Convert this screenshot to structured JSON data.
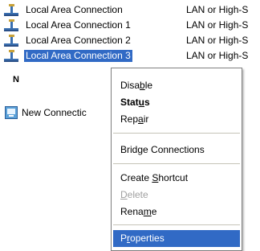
{
  "connections": [
    {
      "name": "Local Area Connection",
      "type": "LAN or High-S"
    },
    {
      "name": "Local Area Connection 1",
      "type": "LAN or High-S"
    },
    {
      "name": "Local Area Connection 2",
      "type": "LAN or High-S"
    },
    {
      "name": "Local Area Connection 3",
      "type": "LAN or High-S",
      "selected": true
    }
  ],
  "section_header": "N",
  "new_connection": {
    "label": "New Connectic"
  },
  "context_menu": {
    "items": [
      {
        "pre": "Disa",
        "key": "b",
        "post": "le"
      },
      {
        "pre": "Stat",
        "key": "u",
        "post": "s"
      },
      {
        "pre": "Rep",
        "key": "a",
        "post": "ir"
      },
      {
        "label": "Bridge Connections"
      },
      {
        "pre": "Create ",
        "key": "S",
        "post": "hortcut"
      },
      {
        "pre": "",
        "key": "D",
        "post": "elete"
      },
      {
        "pre": "Rena",
        "key": "m",
        "post": "e"
      },
      {
        "pre": "P",
        "key": "r",
        "post": "operties"
      }
    ]
  },
  "colors": {
    "selection": "#316ac5",
    "disabled_text": "#a0a0a0",
    "menu_border": "#7f7f7f"
  },
  "icons": [
    "network-connection-icon",
    "new-connection-wizard-icon"
  ]
}
